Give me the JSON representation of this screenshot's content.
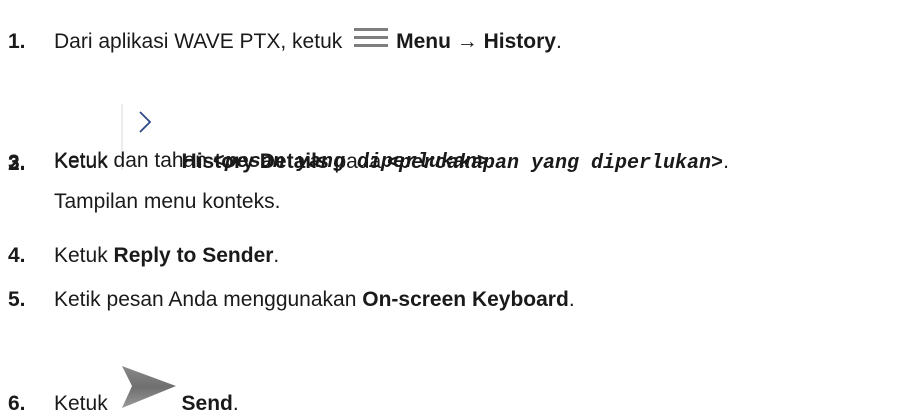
{
  "steps": [
    {
      "number": "1.",
      "pre": "Dari aplikasi WAVE PTX, ketuk",
      "icon": "menu-hamburger-icon",
      "bold1": "Menu",
      "arrow": " → ",
      "bold2": "History",
      "post": "."
    },
    {
      "number": "2.",
      "pre": "Ketuk",
      "icon": "chevron-right-icon",
      "bold": "History Details",
      "mid": " pada ",
      "mono": "<percakapan yang diperlukan>",
      "post": "."
    },
    {
      "number": "3.",
      "pre": "Ketuk dan tahan ",
      "mono": "<pesan yang diperlukan>",
      "post": ".",
      "note": "Tampilan menu konteks."
    },
    {
      "number": "4.",
      "pre": "Ketuk ",
      "bold": "Reply to Sender",
      "post": "."
    },
    {
      "number": "5.",
      "pre": "Ketik pesan Anda menggunakan ",
      "bold": "On-screen Keyboard",
      "post": "."
    },
    {
      "number": "6.",
      "pre": "Ketuk",
      "icon": "send-arrow-icon",
      "bold": "Send",
      "post": "."
    }
  ],
  "colors": {
    "text": "#1a1a1a",
    "icon_gray": "#7f7f7f",
    "chevron_blue": "#2c4a8a"
  }
}
